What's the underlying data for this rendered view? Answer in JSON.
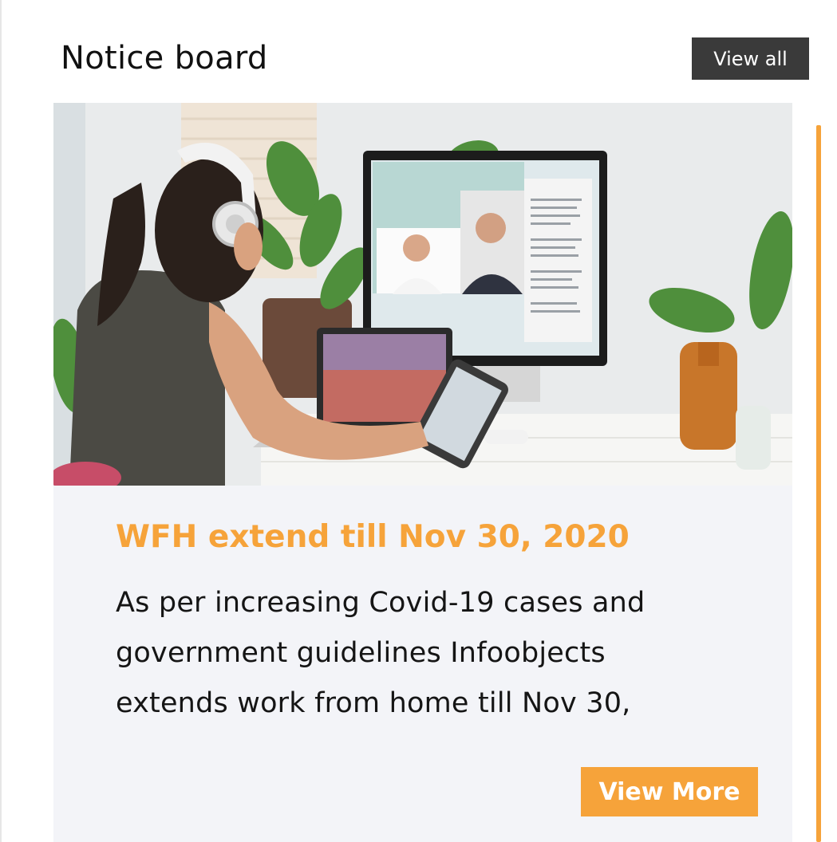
{
  "header": {
    "title": "Notice board",
    "view_all_label": "View all"
  },
  "notice": {
    "title": "WFH extend till Nov 30, 2020",
    "body": "As per increasing Covid-19 cases and government guidelines Infoobjects extends work from home till Nov 30,",
    "view_more_label": "View More",
    "image_description_icon": "work-from-home-photo"
  },
  "colors": {
    "accent": "#f6a33a",
    "dark_button": "#3a3a3a",
    "card_bg": "#f3f4f8"
  }
}
